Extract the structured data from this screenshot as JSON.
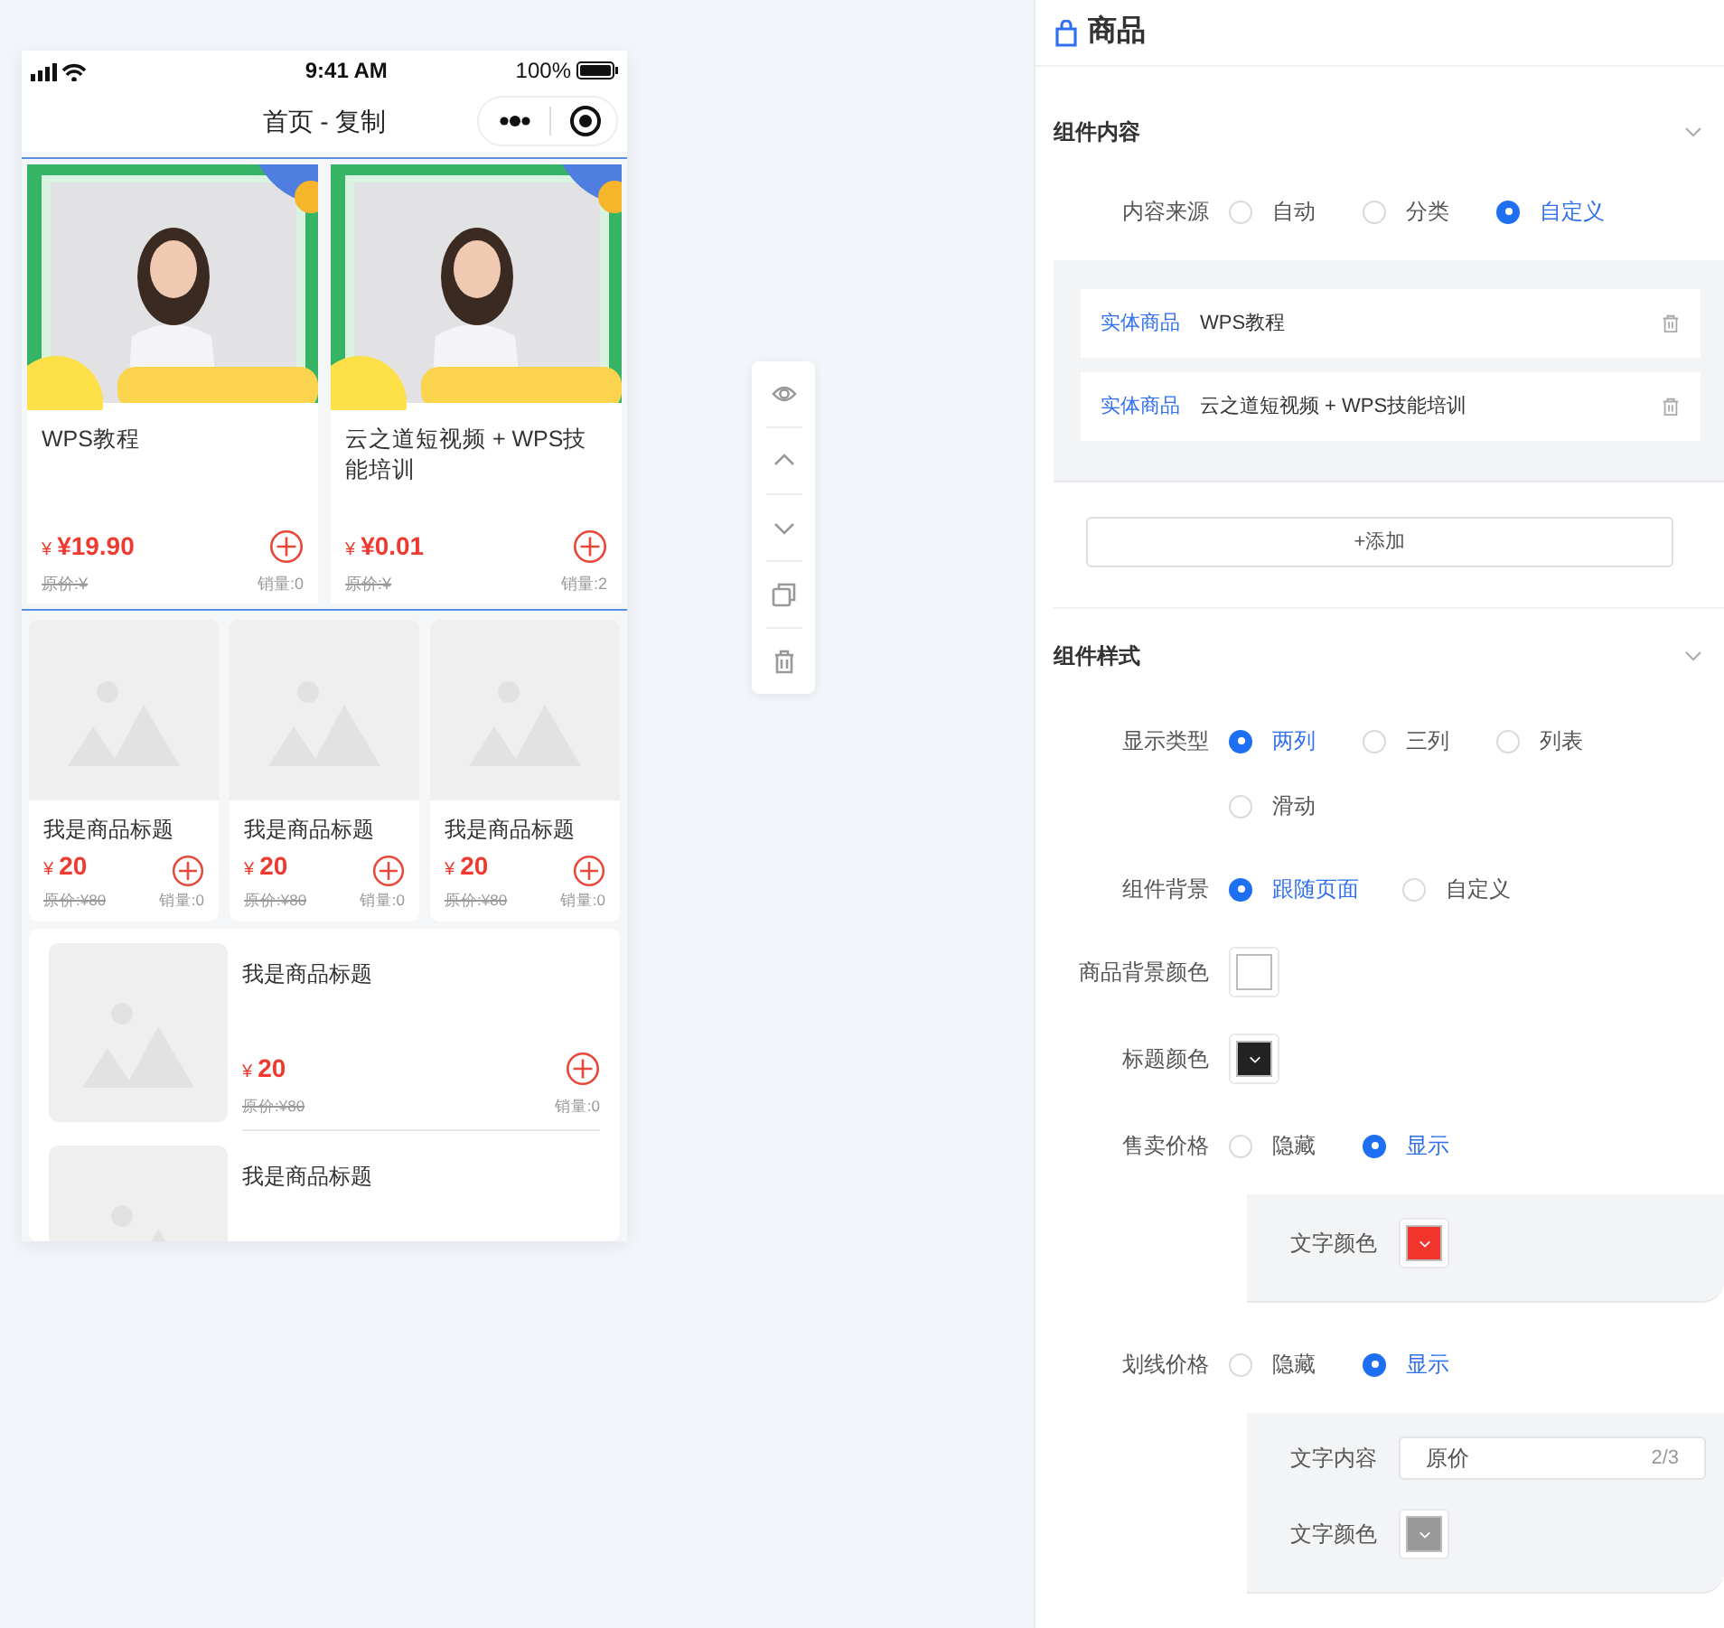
{
  "phone": {
    "status_bar": {
      "time": "9:41 AM",
      "battery": "100%"
    },
    "nav": {
      "title": "首页 - 复制"
    },
    "featured": {
      "selected": true,
      "products": [
        {
          "title": "WPS教程",
          "currency": "¥",
          "price": "¥19.90",
          "original": "原价:¥",
          "sales": "销量:0"
        },
        {
          "title": "云之道短视频 + WPS技能培训",
          "currency": "¥",
          "price": "¥0.01",
          "original": "原价:¥",
          "sales": "销量:2"
        }
      ]
    },
    "three_column": [
      {
        "title": "我是商品标题",
        "currency": "¥",
        "price": "20",
        "original": "原价:¥80",
        "sales": "销量:0"
      },
      {
        "title": "我是商品标题",
        "currency": "¥",
        "price": "20",
        "original": "原价:¥80",
        "sales": "销量:0"
      },
      {
        "title": "我是商品标题",
        "currency": "¥",
        "price": "20",
        "original": "原价:¥80",
        "sales": "销量:0"
      }
    ],
    "list": [
      {
        "title": "我是商品标题",
        "currency": "¥",
        "price": "20",
        "original": "原价:¥80",
        "sales": "销量:0"
      },
      {
        "title": "我是商品标题"
      }
    ]
  },
  "panel": {
    "title": "商品",
    "content_section": {
      "title": "组件内容",
      "source": {
        "label": "内容来源",
        "options": [
          {
            "label": "自动",
            "selected": false
          },
          {
            "label": "分类",
            "selected": false
          },
          {
            "label": "自定义",
            "selected": true
          }
        ]
      },
      "items": [
        {
          "tag": "实体商品",
          "name": "WPS教程"
        },
        {
          "tag": "实体商品",
          "name": "云之道短视频 + WPS技能培训"
        }
      ],
      "add_button": "+添加"
    },
    "style_section": {
      "title": "组件样式",
      "fields": [
        {
          "kind": "radio",
          "label": "显示类型",
          "options": [
            {
              "label": "两列",
              "selected": true
            },
            {
              "label": "三列",
              "selected": false
            },
            {
              "label": "列表",
              "selected": false
            },
            {
              "label": "滑动",
              "selected": false
            }
          ]
        },
        {
          "kind": "radio",
          "label": "组件背景",
          "options": [
            {
              "label": "跟随页面",
              "selected": true
            },
            {
              "label": "自定义",
              "selected": false
            }
          ]
        },
        {
          "kind": "color",
          "label": "商品背景颜色",
          "color": "#ffffff"
        },
        {
          "kind": "color",
          "label": "标题颜色",
          "color": "#222222"
        },
        {
          "kind": "radio",
          "label": "售卖价格",
          "options": [
            {
              "label": "隐藏",
              "selected": false
            },
            {
              "label": "显示",
              "selected": true
            }
          ],
          "sub": [
            {
              "kind": "color",
              "label": "文字颜色",
              "color": "#f2352a"
            }
          ]
        },
        {
          "kind": "radio",
          "label": "划线价格",
          "options": [
            {
              "label": "隐藏",
              "selected": false
            },
            {
              "label": "显示",
              "selected": true
            }
          ],
          "sub": [
            {
              "kind": "text",
              "label": "文字内容",
              "value": "原价",
              "count": "2/3"
            },
            {
              "kind": "color",
              "label": "文字颜色",
              "color": "#999999"
            }
          ]
        }
      ]
    }
  }
}
